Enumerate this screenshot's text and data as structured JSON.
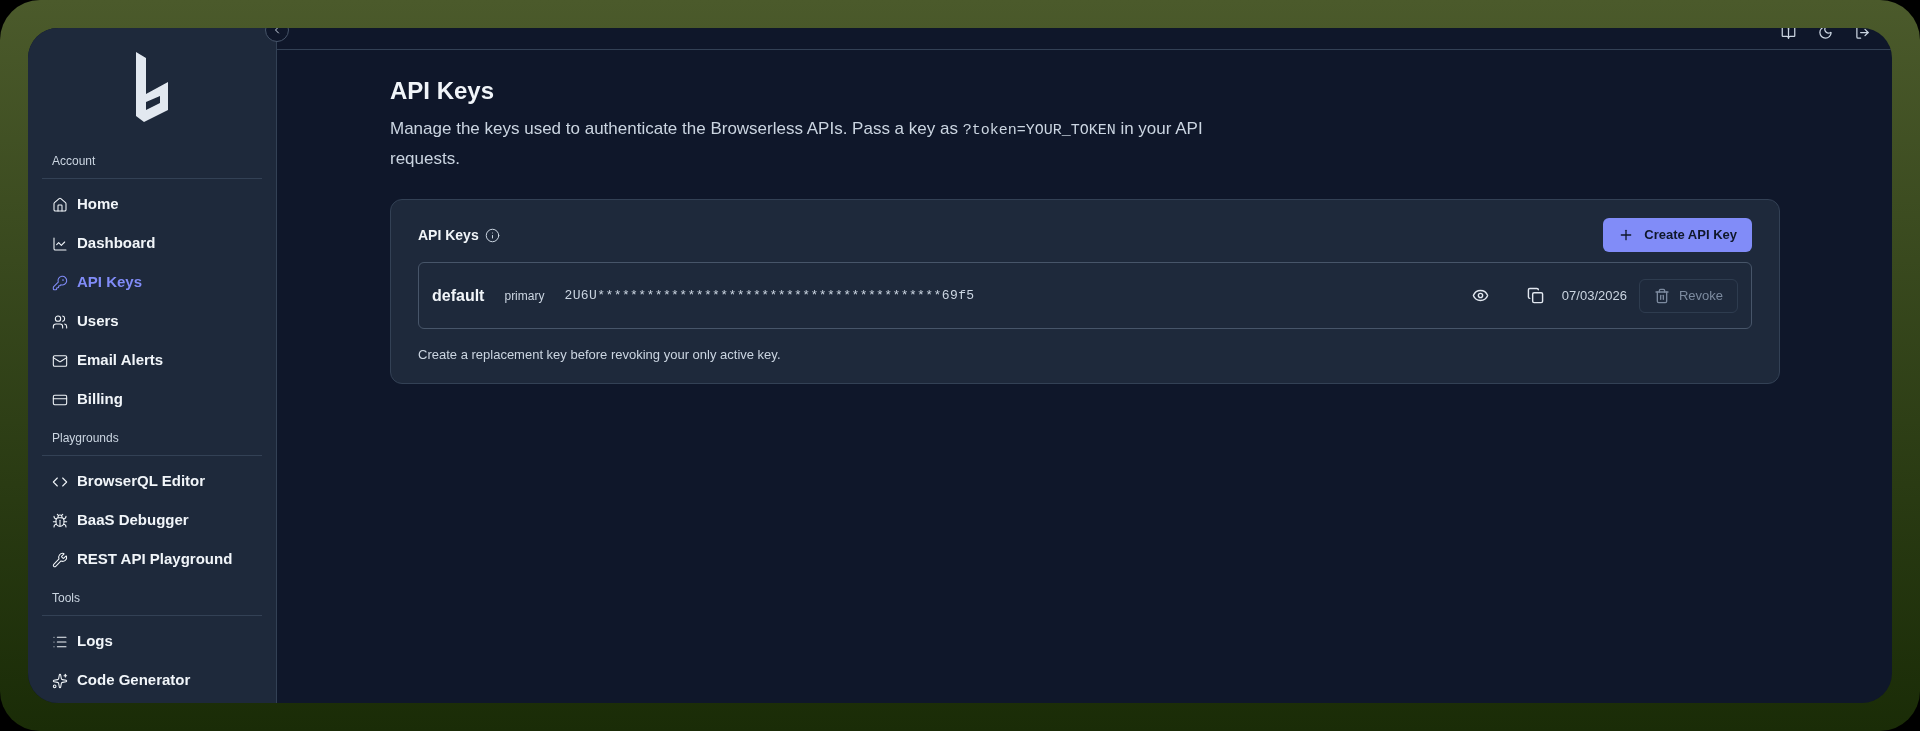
{
  "sidebar": {
    "sections": [
      {
        "title": "Account",
        "items": [
          {
            "label": "Home",
            "selected": false
          },
          {
            "label": "Dashboard",
            "selected": false
          },
          {
            "label": "API Keys",
            "selected": true
          },
          {
            "label": "Users",
            "selected": false
          },
          {
            "label": "Email Alerts",
            "selected": false
          },
          {
            "label": "Billing",
            "selected": false
          }
        ]
      },
      {
        "title": "Playgrounds",
        "items": [
          {
            "label": "BrowserQL Editor",
            "selected": false
          },
          {
            "label": "BaaS Debugger",
            "selected": false
          },
          {
            "label": "REST API Playground",
            "selected": false
          }
        ]
      },
      {
        "title": "Tools",
        "items": [
          {
            "label": "Logs",
            "selected": false
          },
          {
            "label": "Code Generator",
            "selected": false
          }
        ]
      }
    ]
  },
  "page": {
    "title": "API Keys",
    "description": {
      "before": "Manage the keys used to authenticate the Browserless APIs. Pass a key as ",
      "code": "?token=YOUR_TOKEN",
      "after": " in your API requests."
    }
  },
  "card": {
    "title": "API Keys",
    "create_button": "Create API Key",
    "keys": [
      {
        "name": "default",
        "badge": "primary",
        "key": "2U6U******************************************69f5",
        "date": "07/03/2026",
        "revoke": {
          "label": "Revoke",
          "disabled": true
        }
      }
    ],
    "note": "Create a replacement key before revoking your only active key."
  }
}
